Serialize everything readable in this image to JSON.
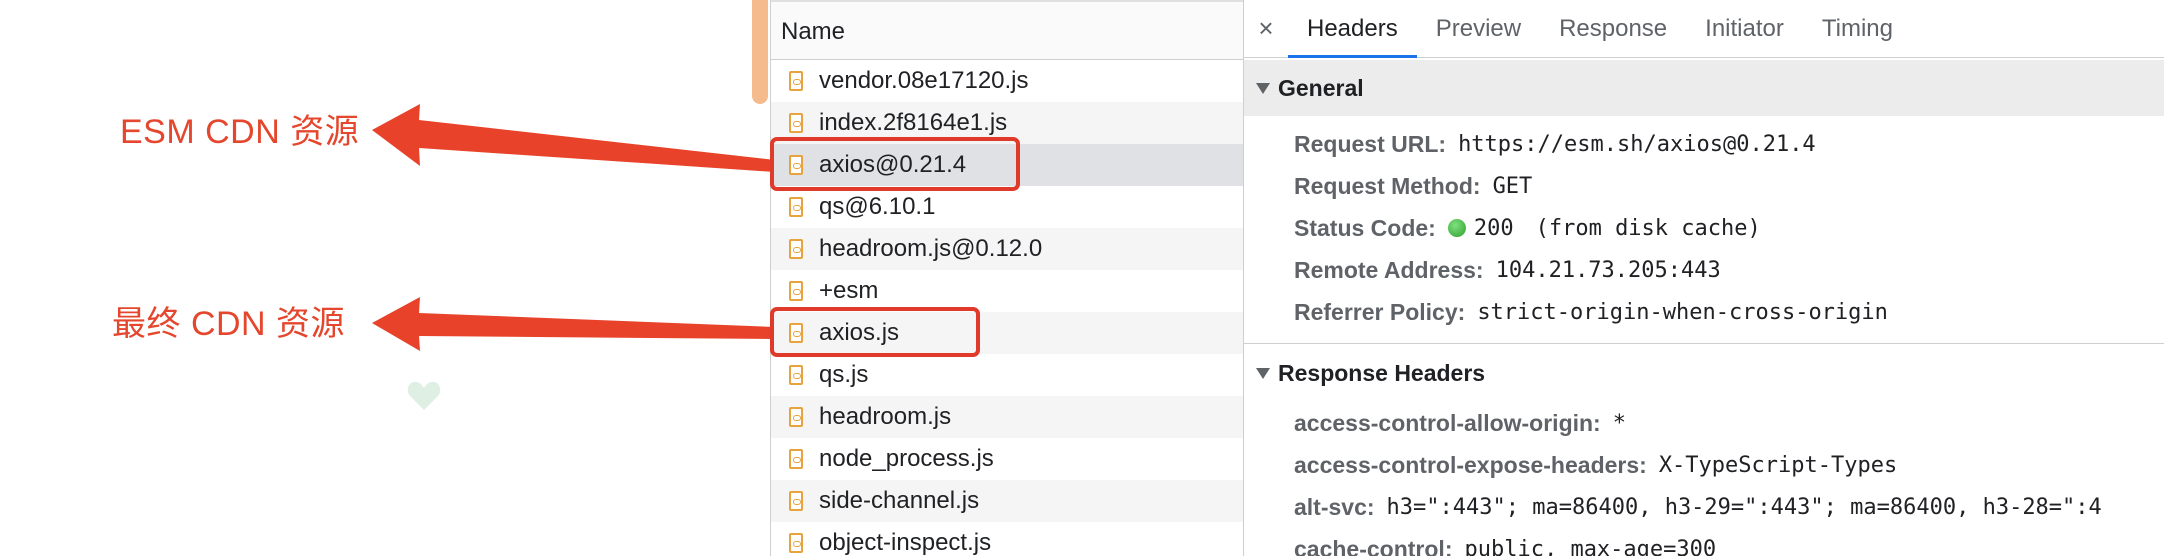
{
  "annotations": [
    {
      "label": "ESM CDN 资源"
    },
    {
      "label": "最终 CDN 资源"
    }
  ],
  "colors": {
    "annotation": "#e4472d",
    "highlight": "#e03a2a",
    "accent": "#1a73e8"
  },
  "name_panel": {
    "header": "Name",
    "files": [
      {
        "name": "vendor.08e17120.js"
      },
      {
        "name": "index.2f8164e1.js"
      },
      {
        "name": "axios@0.21.4",
        "selected": true
      },
      {
        "name": "qs@6.10.1"
      },
      {
        "name": "headroom.js@0.12.0"
      },
      {
        "name": "+esm"
      },
      {
        "name": "axios.js"
      },
      {
        "name": "qs.js"
      },
      {
        "name": "headroom.js"
      },
      {
        "name": "node_process.js"
      },
      {
        "name": "side-channel.js"
      },
      {
        "name": "object-inspect.js"
      }
    ]
  },
  "detail_panel": {
    "close_icon": "×",
    "tabs": [
      {
        "label": "Headers",
        "active": true
      },
      {
        "label": "Preview"
      },
      {
        "label": "Response"
      },
      {
        "label": "Initiator"
      },
      {
        "label": "Timing"
      }
    ],
    "general": {
      "title": "General",
      "rows": [
        {
          "key": "Request URL:",
          "value": "https://esm.sh/axios@0.21.4"
        },
        {
          "key": "Request Method:",
          "value": "GET"
        },
        {
          "key": "Status Code:",
          "value": "200",
          "note": "(from disk cache)",
          "status_color": "#2ca02c"
        },
        {
          "key": "Remote Address:",
          "value": "104.21.73.205:443"
        },
        {
          "key": "Referrer Policy:",
          "value": "strict-origin-when-cross-origin"
        }
      ]
    },
    "response_headers": {
      "title": "Response Headers",
      "rows": [
        {
          "key": "access-control-allow-origin:",
          "value": "*"
        },
        {
          "key": "access-control-expose-headers:",
          "value": "X-TypeScript-Types"
        },
        {
          "key": "alt-svc:",
          "value": "h3=\":443\"; ma=86400, h3-29=\":443\"; ma=86400, h3-28=\":4"
        },
        {
          "key": "cache-control:",
          "value": "public, max-age=300"
        }
      ]
    }
  }
}
